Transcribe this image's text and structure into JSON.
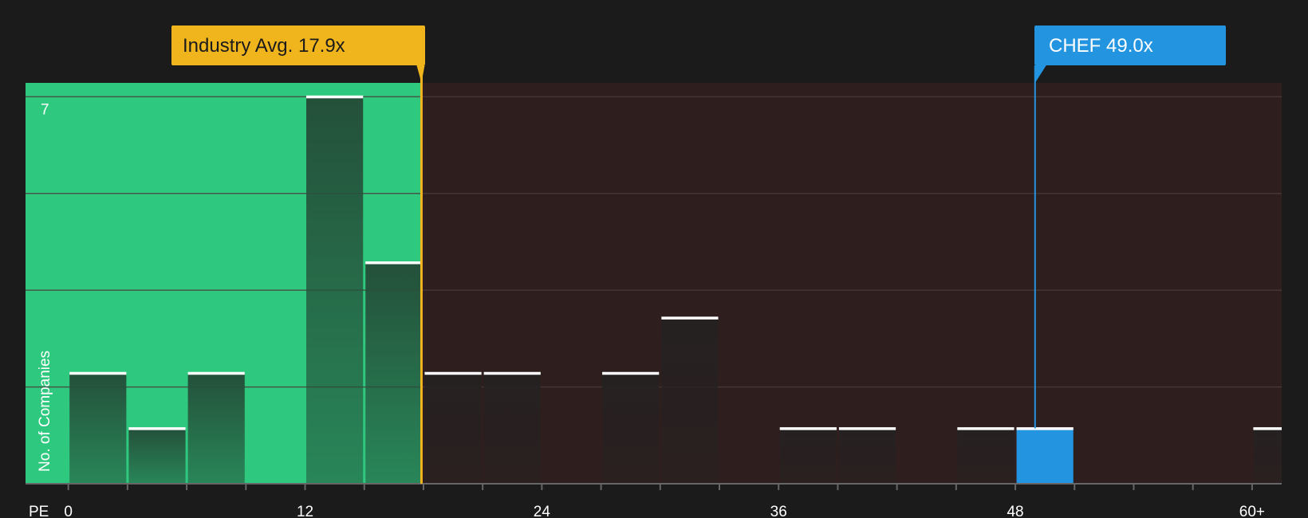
{
  "chart_data": {
    "type": "bar",
    "ylabel": "No. of Companies",
    "xlabel": "PE",
    "x_tick_labels": [
      "0",
      "12",
      "24",
      "36",
      "48",
      "60+"
    ],
    "x_tick_values": [
      0,
      12,
      24,
      36,
      48,
      60
    ],
    "y_tick_labels": [
      "7"
    ],
    "y_tick_values": [
      7
    ],
    "xlim": [
      -2.17,
      61.5
    ],
    "ylim": [
      0,
      7.25
    ],
    "bin_width": 3,
    "bars": [
      {
        "x_start": 0,
        "x_end": 3,
        "value": 2
      },
      {
        "x_start": 3,
        "x_end": 6,
        "value": 1
      },
      {
        "x_start": 6,
        "x_end": 9,
        "value": 2
      },
      {
        "x_start": 12,
        "x_end": 15,
        "value": 7
      },
      {
        "x_start": 15,
        "x_end": 18,
        "value": 4
      },
      {
        "x_start": 18,
        "x_end": 21,
        "value": 2
      },
      {
        "x_start": 21,
        "x_end": 24,
        "value": 2
      },
      {
        "x_start": 27,
        "x_end": 30,
        "value": 2
      },
      {
        "x_start": 30,
        "x_end": 33,
        "value": 3
      },
      {
        "x_start": 36,
        "x_end": 39,
        "value": 1
      },
      {
        "x_start": 39,
        "x_end": 42,
        "value": 1
      },
      {
        "x_start": 45,
        "x_end": 48,
        "value": 1
      },
      {
        "x_start": 48,
        "x_end": 51,
        "value": 1,
        "highlight": true
      },
      {
        "x_start": 60,
        "x_end": 63,
        "value": 1
      }
    ],
    "industry_avg": {
      "label": "Industry Avg. 17.9x",
      "value": 17.9
    },
    "company": {
      "label": "CHEF 49.0x",
      "value": 49.0
    },
    "grid": true,
    "colors": {
      "background": "#1b1b1b",
      "below_avg_zone": "#2ec97e",
      "above_avg_zone": "#2f1e1e",
      "bar_below": "#24503a",
      "bar_above": "#262121",
      "bar_highlight": "#2394e0",
      "bar_cap": "#ffffff",
      "industry_avg": "#f0b41c",
      "company": "#2394e0",
      "grid": "#4a3d3d",
      "axis": "#666666",
      "text": "#ffffff",
      "avg_text": "#1b1b1b"
    }
  }
}
